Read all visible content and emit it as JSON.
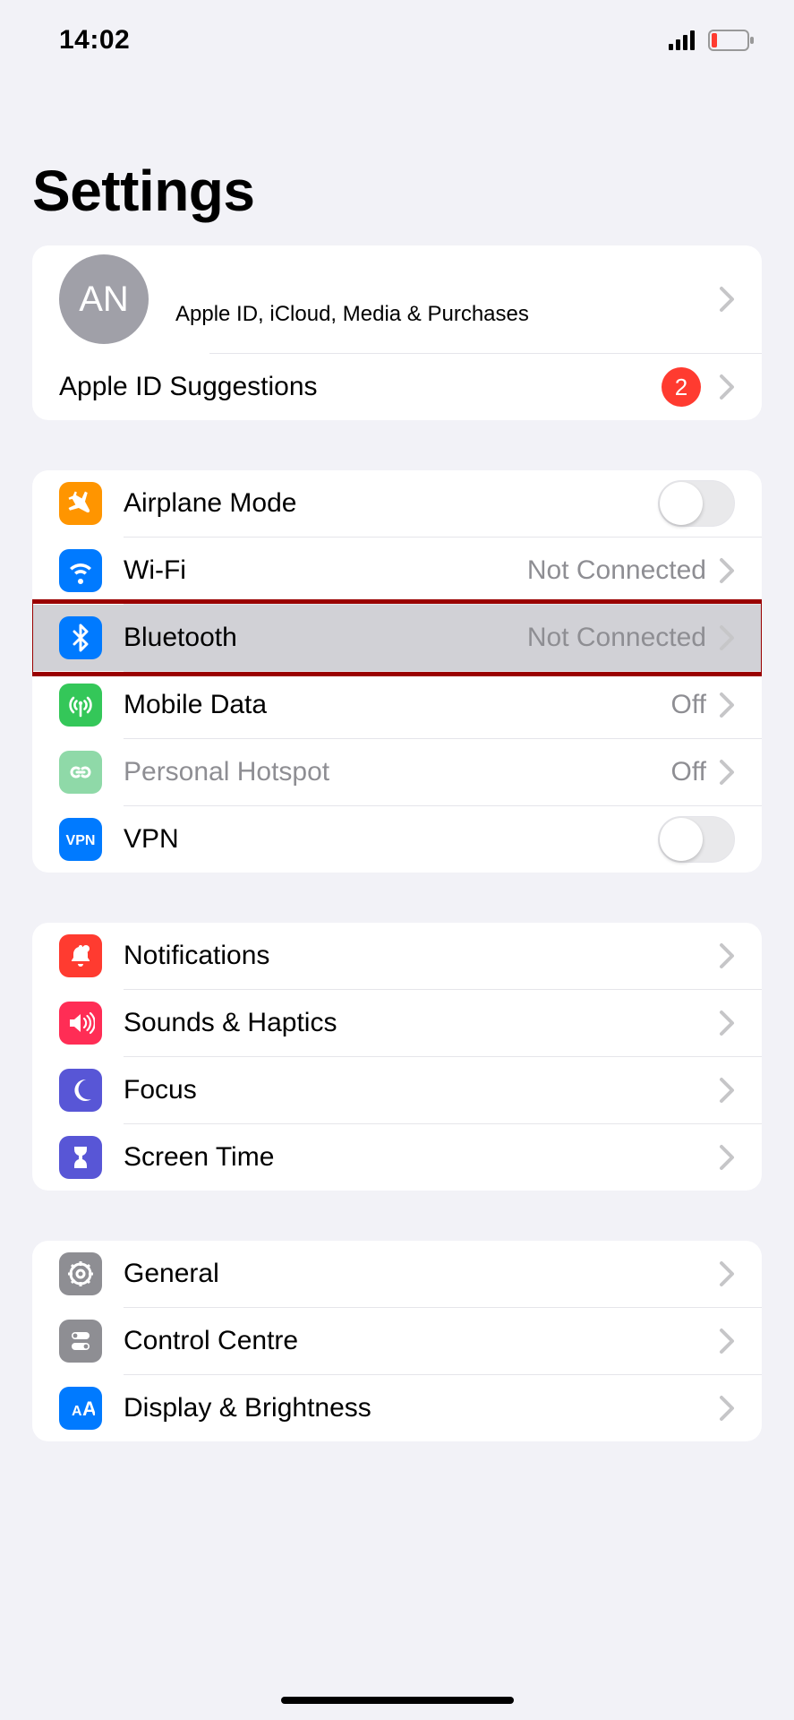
{
  "statusbar": {
    "time": "14:02"
  },
  "page_title": "Settings",
  "apple_id": {
    "initials": "AN",
    "subtitle": "Apple ID, iCloud, Media & Purchases",
    "suggestions_label": "Apple ID Suggestions",
    "suggestions_badge": "2"
  },
  "connectivity": {
    "airplane": {
      "label": "Airplane Mode"
    },
    "wifi": {
      "label": "Wi-Fi",
      "detail": "Not Connected"
    },
    "bluetooth": {
      "label": "Bluetooth",
      "detail": "Not Connected"
    },
    "mobile": {
      "label": "Mobile Data",
      "detail": "Off"
    },
    "hotspot": {
      "label": "Personal Hotspot",
      "detail": "Off"
    },
    "vpn": {
      "label": "VPN"
    }
  },
  "attention": {
    "notifications": {
      "label": "Notifications"
    },
    "sounds": {
      "label": "Sounds & Haptics"
    },
    "focus": {
      "label": "Focus"
    },
    "screentime": {
      "label": "Screen Time"
    }
  },
  "general_group": {
    "general": {
      "label": "General"
    },
    "controlcentre": {
      "label": "Control Centre"
    },
    "display": {
      "label": "Display & Brightness"
    }
  },
  "colors": {
    "orange": "#ff9500",
    "blue": "#007aff",
    "green": "#34c759",
    "lightgreen": "#8fd9a8",
    "red": "#ff3b30",
    "pink": "#ff2d55",
    "indigo": "#5856d6",
    "grey": "#8e8e93"
  }
}
